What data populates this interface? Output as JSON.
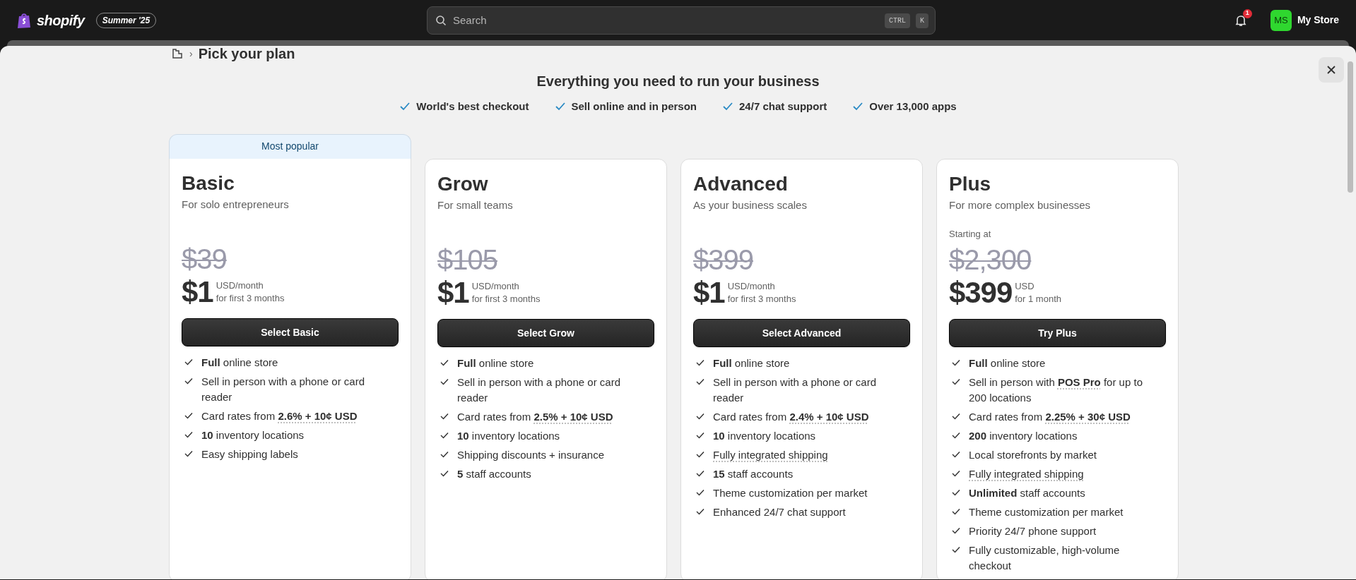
{
  "topbar": {
    "logo": "shopify",
    "edition_badge": "Summer '25",
    "search": {
      "placeholder": "Search",
      "shortcut": [
        "CTRL",
        "K"
      ]
    },
    "notifications": "1",
    "store": {
      "initials": "MS",
      "name": "My Store"
    }
  },
  "breadcrumb": {
    "separator": "›",
    "current": "Pick your plan"
  },
  "header": {
    "title": "Everything you need to run your business",
    "highlights": [
      "World's best checkout",
      "Sell online and in person",
      "24/7 chat support",
      "Over 13,000 apps"
    ]
  },
  "plans": [
    {
      "name": "Basic",
      "tagline": "For solo entrepreneurs",
      "ribbon": "Most popular",
      "old_price": "$39",
      "price": "$1",
      "unit": "USD/month",
      "term": "for first 3 months",
      "button": "Select Basic",
      "features": [
        {
          "text": "**Full** online store",
          "dotted": false
        },
        {
          "text": "Sell in person with a phone or card reader",
          "dotted": false
        },
        {
          "text": "Card rates from **2.6% + 10¢ USD**",
          "dotted": true
        },
        {
          "text": "**10** inventory locations",
          "dotted": false
        },
        {
          "text": "Easy shipping labels",
          "dotted": false
        }
      ]
    },
    {
      "name": "Grow",
      "tagline": "For small teams",
      "old_price": "$105",
      "price": "$1",
      "unit": "USD/month",
      "term": "for first 3 months",
      "button": "Select Grow",
      "features": [
        {
          "text": "**Full** online store",
          "dotted": false
        },
        {
          "text": "Sell in person with a phone or card reader",
          "dotted": false
        },
        {
          "text": "Card rates from **2.5% + 10¢ USD**",
          "dotted": true
        },
        {
          "text": "**10** inventory locations",
          "dotted": false
        },
        {
          "text": "Shipping discounts + insurance",
          "dotted": false
        },
        {
          "text": "**5** staff accounts",
          "dotted": false
        }
      ]
    },
    {
      "name": "Advanced",
      "tagline": "As your business scales",
      "old_price": "$399",
      "price": "$1",
      "unit": "USD/month",
      "term": "for first 3 months",
      "button": "Select Advanced",
      "features": [
        {
          "text": "**Full** online store",
          "dotted": false
        },
        {
          "text": "Sell in person with a phone or card reader",
          "dotted": false
        },
        {
          "text": "Card rates from **2.4% + 10¢ USD**",
          "dotted": true
        },
        {
          "text": "**10** inventory locations",
          "dotted": false
        },
        {
          "text": "Fully integrated shipping",
          "dotted": true
        },
        {
          "text": "**15** staff accounts",
          "dotted": false
        },
        {
          "text": "Theme customization per market",
          "dotted": false
        },
        {
          "text": "Enhanced 24/7 chat support",
          "dotted": false
        }
      ]
    },
    {
      "name": "Plus",
      "tagline": "For more complex businesses",
      "starting_label": "Starting at",
      "old_price": "$2,300",
      "price": "$399",
      "unit": "USD",
      "term": "for 1 month",
      "button": "Try Plus",
      "features": [
        {
          "text": "**Full** online store",
          "dotted": false
        },
        {
          "text": "Sell in person with **POS Pro** for up to 200 locations",
          "dotted": true
        },
        {
          "text": "Card rates from **2.25% + 30¢ USD**",
          "dotted": true
        },
        {
          "text": "**200** inventory locations",
          "dotted": false
        },
        {
          "text": "Local storefronts by market",
          "dotted": false
        },
        {
          "text": "Fully integrated shipping",
          "dotted": true
        },
        {
          "text": "**Unlimited** staff accounts",
          "dotted": false
        },
        {
          "text": "Theme customization per market",
          "dotted": false
        },
        {
          "text": "Priority 24/7 phone support",
          "dotted": false
        },
        {
          "text": "Fully customizable, high-volume checkout",
          "dotted": false
        }
      ]
    }
  ]
}
